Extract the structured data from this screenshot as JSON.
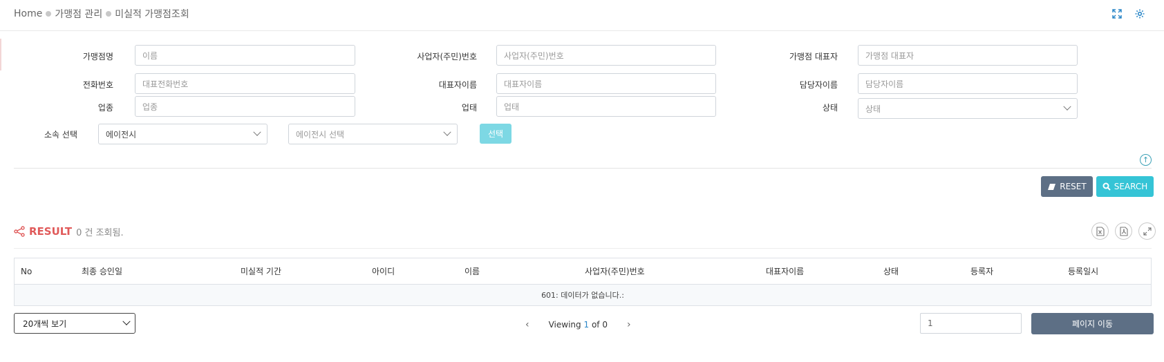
{
  "breadcrumb": [
    "Home",
    "가맹점 관리",
    "미실적 가맹점조회"
  ],
  "top_icons": [
    "fullscreen-icon",
    "settings-icon"
  ],
  "search_form": {
    "store_name": {
      "label": "가맹점명",
      "placeholder": "이름"
    },
    "biz_no": {
      "label": "사업자(주민)번호",
      "placeholder": "사업자(주민)번호"
    },
    "rep_name": {
      "label": "가맹점 대표자",
      "placeholder": "가맹점 대표자"
    },
    "phone": {
      "label": "전화번호",
      "placeholder": "대표전화번호"
    },
    "rep_person": {
      "label": "대표자이름",
      "placeholder": "대표자이름"
    },
    "manager": {
      "label": "담당자이름",
      "placeholder": "담당자이름"
    },
    "biz_type": {
      "label": "업종",
      "placeholder": "업종"
    },
    "biz_status": {
      "label": "업태",
      "placeholder": "업태"
    },
    "state": {
      "label": "상태",
      "selected": "상태"
    },
    "affiliation": {
      "label": "소속 선택",
      "selected": "에이전시",
      "agency_placeholder": "에이전시 선택",
      "button": "선택"
    }
  },
  "actions": {
    "reset": "RESET",
    "search": "SEARCH"
  },
  "result": {
    "title": "RESULT",
    "count_text": "0 건 조회됨."
  },
  "export_icons": [
    "excel-icon",
    "pdf-icon",
    "expand-icon"
  ],
  "table": {
    "columns": [
      "No",
      "최종 승인일",
      "미실적 기간",
      "아이디",
      "이름",
      "사업자(주민)번호",
      "대표자이름",
      "상태",
      "등록자",
      "등록일시"
    ],
    "empty_message": "601: 데이터가 없습니다.:"
  },
  "pager": {
    "page_size": "20개씩 보기",
    "viewing_prefix": "Viewing",
    "current": "1",
    "of_text": "of 0",
    "page_input": "1",
    "goto": "페이지 이동"
  },
  "colors": {
    "accent": "#35c4d6",
    "dark_button": "#5d6f85",
    "result_title": "#e05a5a",
    "link": "#2b87c8"
  }
}
